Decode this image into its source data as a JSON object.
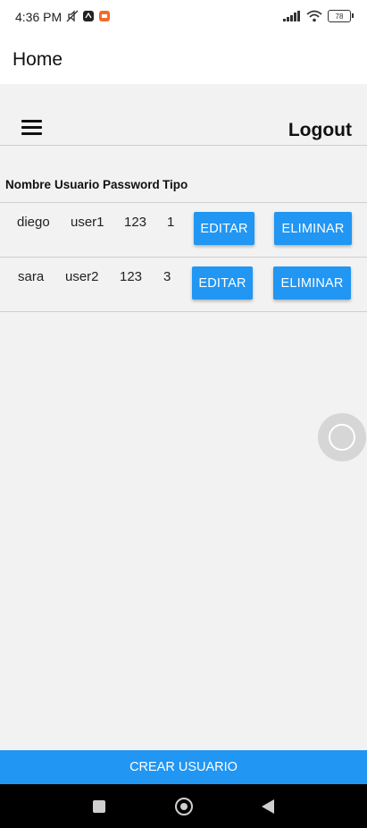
{
  "status_bar": {
    "time": "4:36 PM",
    "battery": "78",
    "icons_left": [
      "mute-icon",
      "app-notification-icon",
      "recording-icon"
    ],
    "icons_right": [
      "signal-icon",
      "wifi-icon",
      "battery-icon"
    ]
  },
  "app_bar": {
    "title": "Home"
  },
  "toolbar": {
    "menu_icon": "hamburger-menu-icon",
    "logout_label": "Logout"
  },
  "table": {
    "headers": [
      "Nombre",
      "Usuario",
      "Password",
      "Tipo"
    ],
    "rows": [
      {
        "nombre": "diego",
        "usuario": "user1",
        "password": "123",
        "tipo": "1",
        "edit_label": "EDITAR",
        "delete_label": "ELIMINAR"
      },
      {
        "nombre": "sara",
        "usuario": "user2",
        "password": "123",
        "tipo": "3",
        "edit_label": "EDITAR",
        "delete_label": "ELIMINAR"
      }
    ]
  },
  "footer": {
    "create_label": "CREAR USUARIO"
  },
  "colors": {
    "accent": "#2196f3",
    "background": "#f2f2f2",
    "nav_bar": "#000000"
  }
}
